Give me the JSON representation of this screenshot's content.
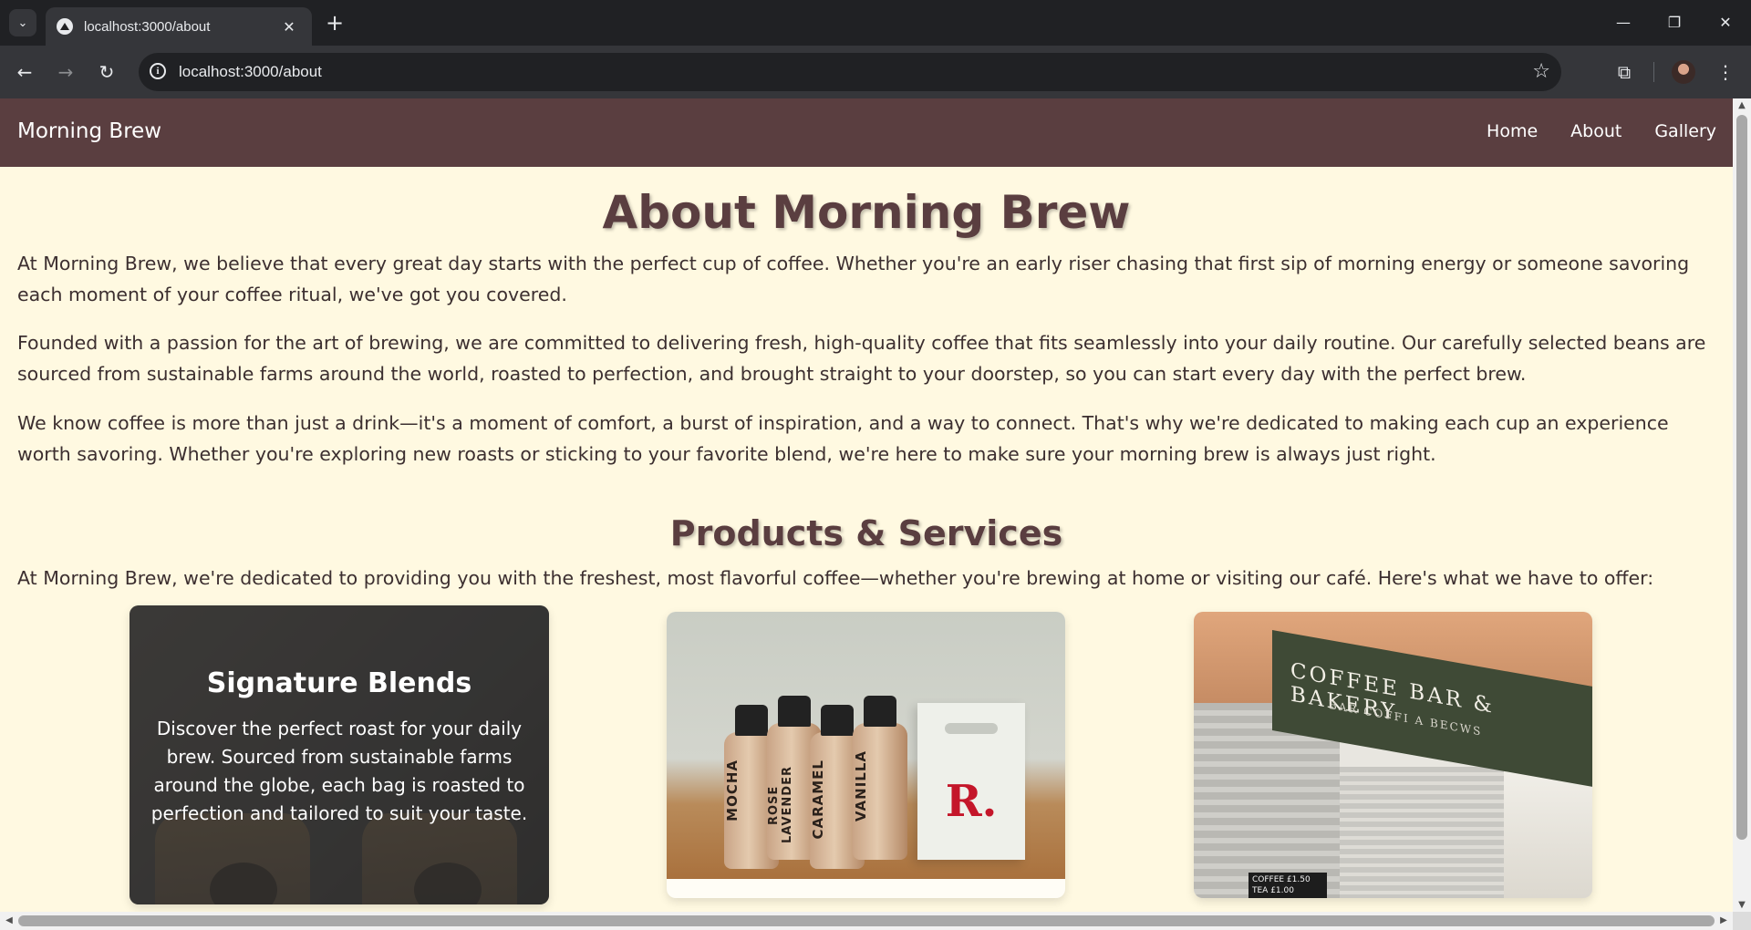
{
  "browser": {
    "tab_title": "localhost:3000/about",
    "url": "localhost:3000/about",
    "icons": {
      "tab_search": "chevron-down-icon",
      "tab_close": "close-icon",
      "new_tab": "plus-icon",
      "back": "arrow-left-icon",
      "forward": "arrow-right-icon",
      "reload": "reload-icon",
      "site_info": "info-icon",
      "bookmark": "star-icon",
      "extensions": "puzzle-icon",
      "profile": "avatar",
      "menu": "kebab-menu-icon"
    },
    "window_controls": {
      "minimize": "—",
      "restore": "❐",
      "close": "✕"
    }
  },
  "site": {
    "brand": "Morning Brew",
    "nav": [
      {
        "label": "Home"
      },
      {
        "label": "About"
      },
      {
        "label": "Gallery"
      }
    ],
    "colors": {
      "nav_bg": "#5a3e40",
      "page_bg": "#fff9e1",
      "heading": "#5a3e40",
      "text": "#3c2f30"
    }
  },
  "about": {
    "title": "About Morning Brew",
    "paragraphs": [
      "At Morning Brew, we believe that every great day starts with the perfect cup of coffee. Whether you're an early riser chasing that first sip of morning energy or someone savoring each moment of your coffee ritual, we've got you covered.",
      "Founded with a passion for the art of brewing, we are committed to delivering fresh, high-quality coffee that fits seamlessly into your daily routine. Our carefully selected beans are sourced from sustainable farms around the world, roasted to perfection, and brought straight to your doorstep, so you can start every day with the perfect brew.",
      "We know coffee is more than just a drink—it's a moment of comfort, a burst of inspiration, and a way to connect. That's why we're dedicated to making each cup an experience worth savoring. Whether you're exploring new roasts or sticking to your favorite blend, we're here to make sure your morning brew is always just right."
    ]
  },
  "products": {
    "title": "Products & Services",
    "intro": "At Morning Brew, we're dedicated to providing you with the freshest, most flavorful coffee—whether you're brewing at home or visiting our café. Here's what we have to offer:",
    "cards": [
      {
        "title": "Signature Blends",
        "text": "Discover the perfect roast for your daily brew. Sourced from sustainable farms around the globe, each bag is roasted to perfection and tailored to suit your taste."
      },
      {
        "bottles": [
          "MOCHA",
          "ROSE LAVENDER",
          "CARAMEL",
          "VANILLA"
        ],
        "carrier_logo": "R."
      },
      {
        "sign": "COFFEE BAR & BAKERY",
        "sign_sub": "BAR COFFI A BECWS",
        "board": "COFFEE £1.50 TEA £1.00"
      }
    ]
  }
}
